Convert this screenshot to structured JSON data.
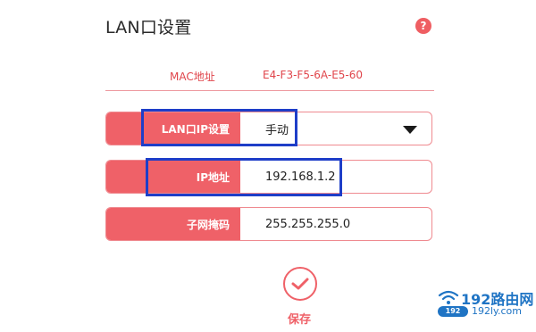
{
  "page": {
    "title": "LAN口设置",
    "help_icon": "question-mark-icon"
  },
  "mac": {
    "label": "MAC地址",
    "value": "E4-F3-F5-6A-E5-60"
  },
  "fields": {
    "lan_ip_setting": {
      "label": "LAN口IP设置",
      "value": "手动"
    },
    "ip_address": {
      "label": "IP地址",
      "value": "192.168.1.2"
    },
    "subnet_mask": {
      "label": "子网掩码",
      "value": "255.255.255.0"
    }
  },
  "save": {
    "label": "保存",
    "icon": "check-icon"
  },
  "watermark": {
    "brand": "192路由网",
    "badge": "192",
    "domain": "192ly.com"
  },
  "colors": {
    "accent": "#ef6168",
    "highlight": "#1e3ec8",
    "watermark": "#1f74c4"
  }
}
